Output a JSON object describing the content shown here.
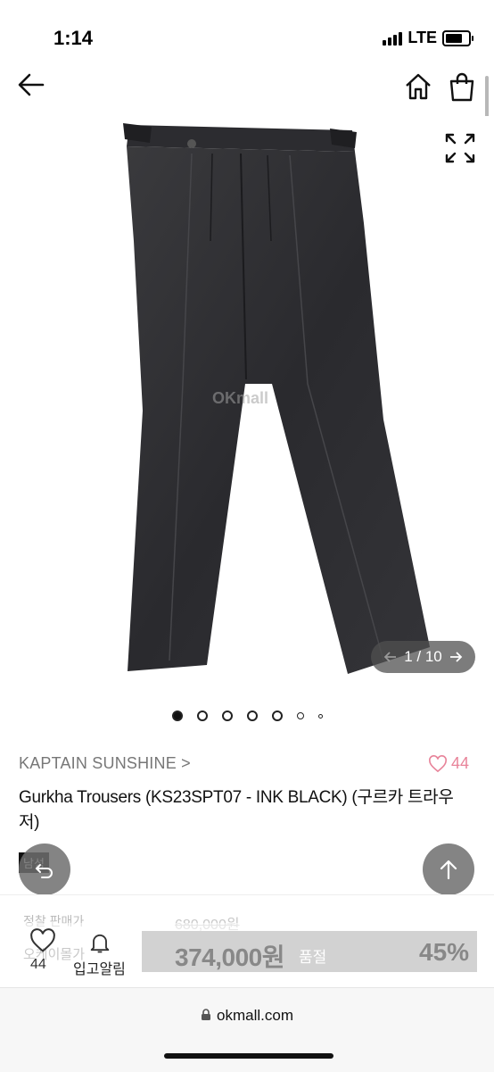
{
  "status": {
    "time": "1:14",
    "network": "LTE"
  },
  "nav": {
    "back_icon": "arrow-left-icon",
    "home_icon": "home-icon",
    "cart_icon": "shopping-bag-icon"
  },
  "gallery": {
    "watermark": "OKmall",
    "counter": "1 / 10",
    "total_dots": 7,
    "active_dot": 1
  },
  "product": {
    "brand": "KAPTAIN SUNSHINE >",
    "like_count": "44",
    "title": "Gurkha Trousers (KS23SPT07 - INK BLACK) (구르카 트라우저)",
    "gender_badge": "남성"
  },
  "pricing": {
    "label": "정찰 판매가",
    "original_price": "680,000원",
    "sale_price": "374,000원",
    "status": "품절",
    "discount": "45%"
  },
  "bottom_bar": {
    "wish_label": "오케이몰가",
    "wish_count": "44",
    "alarm_label": "입고알림"
  },
  "browser": {
    "url": "okmall.com"
  },
  "colors": {
    "like": "#e8849a",
    "price_bar": "#d2d2d2"
  }
}
